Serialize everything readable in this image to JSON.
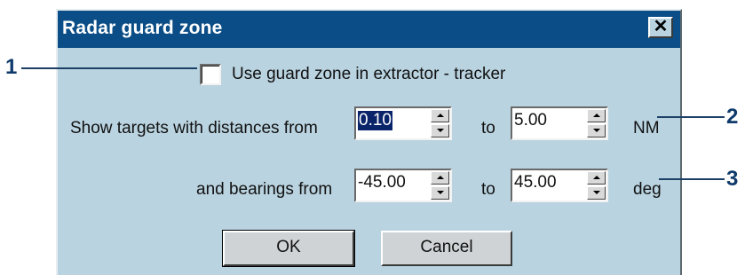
{
  "dialog": {
    "title": "Radar guard zone",
    "close_glyph": "✕",
    "checkbox_label": "Use guard zone in extractor - tracker",
    "checkbox_checked": false,
    "distances_label": "Show targets with distances from",
    "distance_from": "0.10",
    "to_label": "to",
    "distance_to": "5.00",
    "distance_unit": "NM",
    "bearings_label": "and bearings from",
    "bearing_from": "-45.00",
    "bearing_to": "45.00",
    "bearing_unit": "deg",
    "ok_label": "OK",
    "cancel_label": "Cancel"
  },
  "callouts": {
    "one": "1",
    "two": "2",
    "three": "3"
  },
  "colors": {
    "dialog_bg": "#b9d3e0",
    "titlebar_bg": "#0b4d86",
    "callout": "#0f3a6b"
  }
}
